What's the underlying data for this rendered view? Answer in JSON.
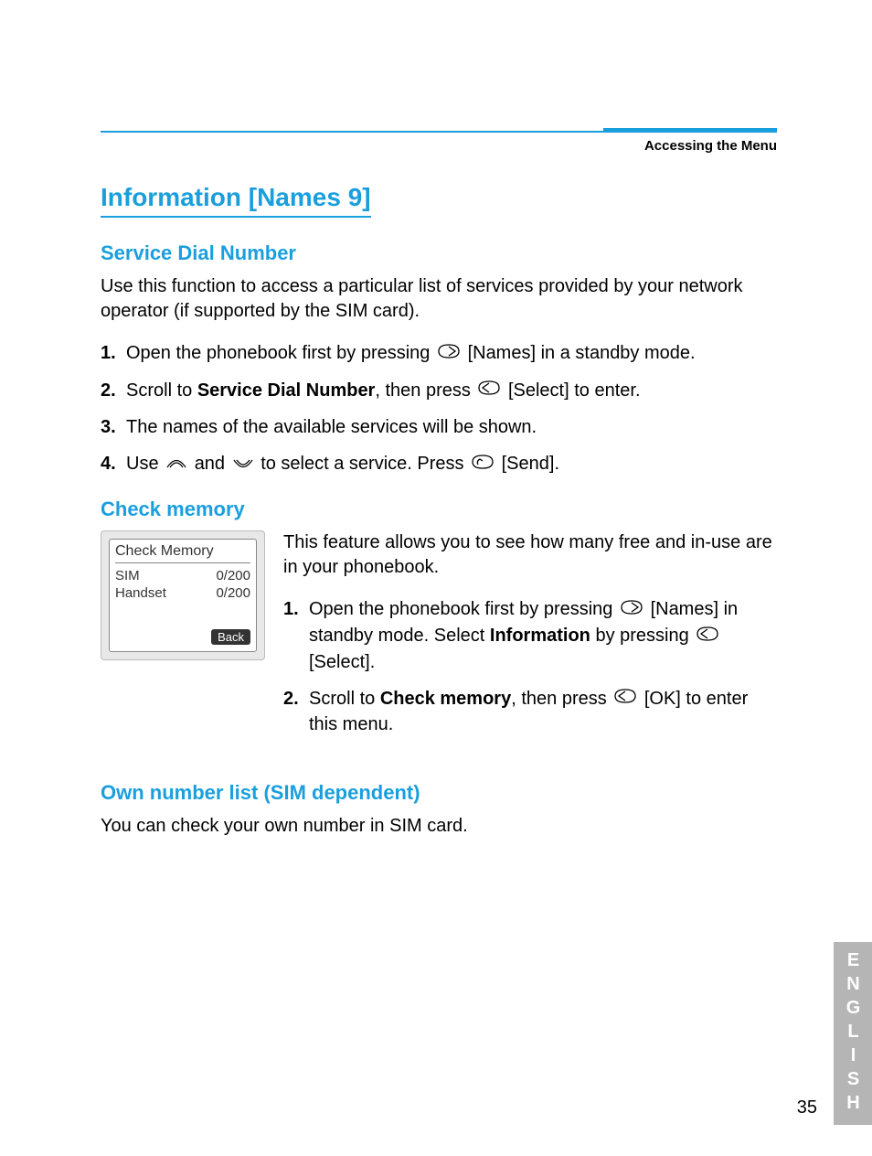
{
  "breadcrumb": "Accessing the Menu",
  "title": "Information [Names 9]",
  "section1": {
    "heading": "Service Dial Number",
    "intro": "Use this function to access a particular list of services provided by your network operator (if supported by the SIM card).",
    "steps": {
      "s1_a": "Open the phonebook first by pressing ",
      "s1_b": " [Names] in a standby mode.",
      "s2_a": "Scroll to ",
      "s2_bold": "Service Dial Number",
      "s2_b": ", then press ",
      "s2_c": " [Select] to enter.",
      "s3": "The names of the available services will be shown.",
      "s4_a": "Use ",
      "s4_b": " and ",
      "s4_c": " to select a service. Press ",
      "s4_d": "[Send]."
    }
  },
  "section2": {
    "heading": "Check memory",
    "intro": "This feature allows you to see how many free and in-use are in your phonebook.",
    "phone": {
      "title": "Check Memory",
      "rows": [
        {
          "label": "SIM",
          "value": "0/200"
        },
        {
          "label": "Handset",
          "value": "0/200"
        }
      ],
      "back": "Back"
    },
    "steps": {
      "s1_a": "Open the phonebook first by pressing",
      "s1_b": " [Names] in standby mode. Select ",
      "s1_bold": "Information",
      "s1_c": " by pressing ",
      "s1_d": " [Select].",
      "s2_a": "Scroll to ",
      "s2_bold": "Check memory",
      "s2_b": ", then press ",
      "s2_c": " [OK] to enter this menu."
    }
  },
  "section3": {
    "heading": "Own number list (SIM dependent)",
    "intro": "You can check your own number in SIM card."
  },
  "sideTab": "ENGLISH",
  "pageNumber": "35"
}
